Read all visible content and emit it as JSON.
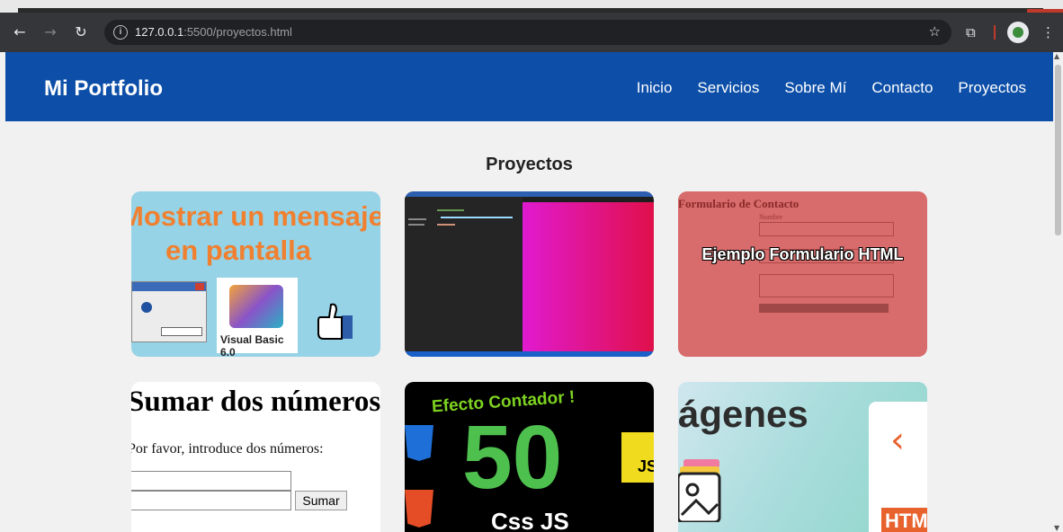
{
  "browser": {
    "url_host": "127.0.0.1",
    "url_path": ":5500/proyectos.html"
  },
  "site": {
    "brand": "Mi Portfolio",
    "nav": [
      "Inicio",
      "Servicios",
      "Sobre Mí",
      "Contacto",
      "Proyectos"
    ]
  },
  "section_title": "Proyectos",
  "cards": {
    "c1": {
      "line1": "Mostrar un mensaje",
      "line2": "en pantalla",
      "vb_label": "Visual Basic 6.0"
    },
    "c3": {
      "form_title": "Formulario de Contacto",
      "overlay": "Ejemplo Formulario HTML"
    },
    "c4": {
      "heading": "Sumar dos números",
      "text": "Por favor, introduce dos números:",
      "button": "Sumar"
    },
    "c5": {
      "title": "Efecto Contador !",
      "number": "50",
      "subtitle": "Css JS",
      "js": "JS"
    },
    "c6": {
      "title": "ágenes",
      "tag": "HTML"
    }
  }
}
